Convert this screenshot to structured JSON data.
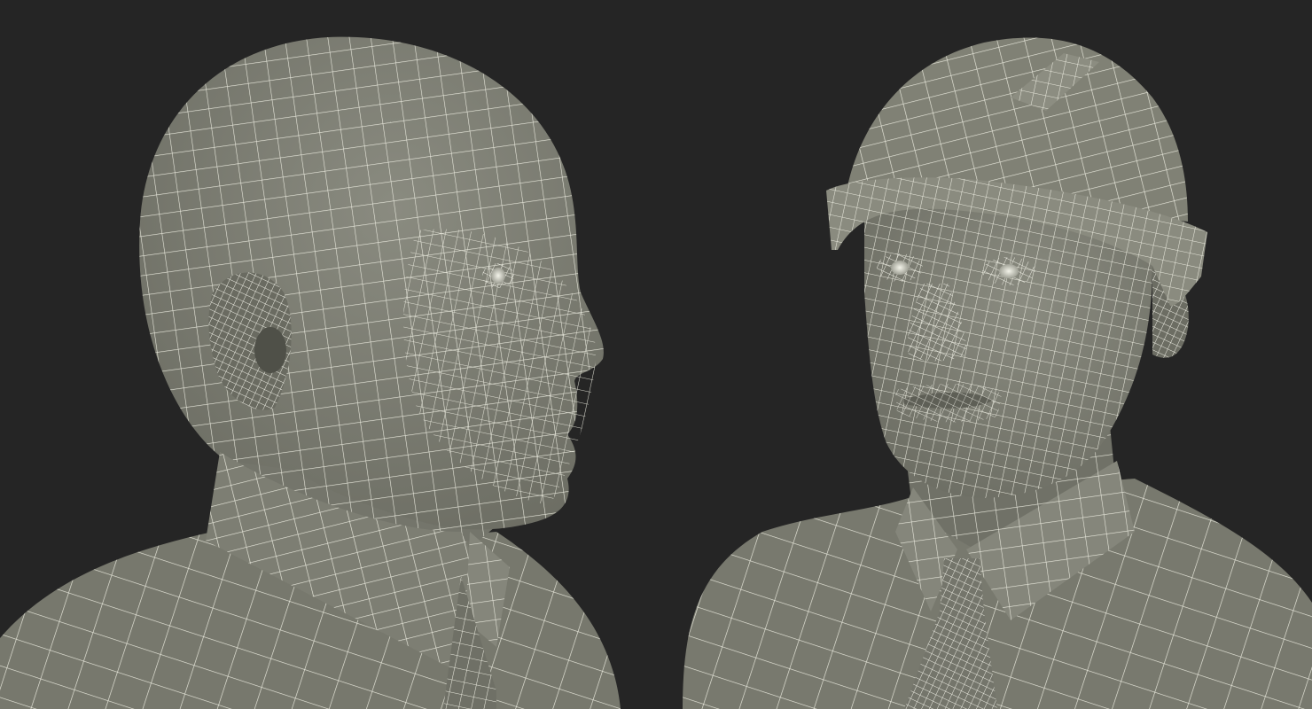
{
  "scene": {
    "background_color": "#252525",
    "mesh_fill_color": "#7e7f74",
    "mesh_shadow_color": "#5f6057",
    "wire_color": "#e9e9dd",
    "views": [
      {
        "name": "side-view",
        "subject": "male-head-profile",
        "has_hard_hat": false
      },
      {
        "name": "front-view",
        "subject": "male-head-three-quarter",
        "has_hard_hat": true
      }
    ]
  }
}
